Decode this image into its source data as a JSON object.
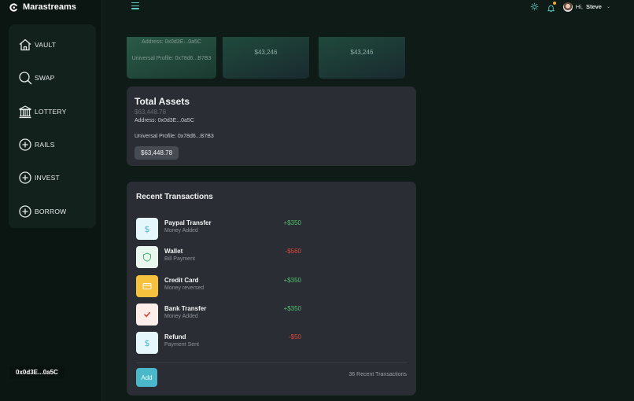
{
  "app": {
    "name": "Marastreams"
  },
  "sidebar": {
    "items": [
      {
        "label": "VAULT",
        "icon": "home-icon"
      },
      {
        "label": "SWAP",
        "icon": "search-icon"
      },
      {
        "label": "LOTTERY",
        "icon": "bank-icon"
      },
      {
        "label": "RAILS",
        "icon": "plus-circle-icon"
      },
      {
        "label": "INVEST",
        "icon": "plus-circle-icon"
      },
      {
        "label": "BORROW",
        "icon": "plus-circle-icon"
      }
    ],
    "wallet_address": "0x0d3E...0a5C"
  },
  "topbar": {
    "greeting": "Hi,",
    "user_name": "Steve"
  },
  "cards": [
    {
      "address": "Address: 0x0d3E...0a5C",
      "profile": "Universal Profile: 0x78d6...B7B3"
    },
    {
      "amount": "$43,246"
    },
    {
      "amount": "$43,246"
    }
  ],
  "assets": {
    "title": "Total Assets",
    "subtitle": "$63,448.78",
    "address": "Address: 0x0d3E...0a5C",
    "profile": "Universal Profile: 0x78d6...B7B3",
    "balance": "$63,448.78"
  },
  "transactions": {
    "title": "Recent Transactions",
    "items": [
      {
        "name": "Paypal Transfer",
        "desc": "Money Added",
        "amount": "+$350",
        "type": "pos",
        "icon": "dollar-icon",
        "icon_bg": "#e6f7fb",
        "icon_color": "#3fb4c9"
      },
      {
        "name": "Wallet",
        "desc": "Bill Payment",
        "amount": "-$560",
        "type": "neg",
        "icon": "shield-icon",
        "icon_bg": "#e9f7ef",
        "icon_color": "#3fb36a"
      },
      {
        "name": "Credit Card",
        "desc": "Money reversed",
        "amount": "+$350",
        "type": "pos",
        "icon": "credit-card-icon",
        "icon_bg": "#f6c23e",
        "icon_color": "#ffffff"
      },
      {
        "name": "Bank Transfer",
        "desc": "Money Added",
        "amount": "+$350",
        "type": "pos",
        "icon": "check-icon",
        "icon_bg": "#fdeee9",
        "icon_color": "#e0453d"
      },
      {
        "name": "Refund",
        "desc": "Payment Sent",
        "amount": "-$50",
        "type": "neg",
        "icon": "dollar-icon",
        "icon_bg": "#e6f7fb",
        "icon_color": "#3fb4c9"
      }
    ],
    "add_label": "Add",
    "count_label": "36 Recent Transactions"
  }
}
